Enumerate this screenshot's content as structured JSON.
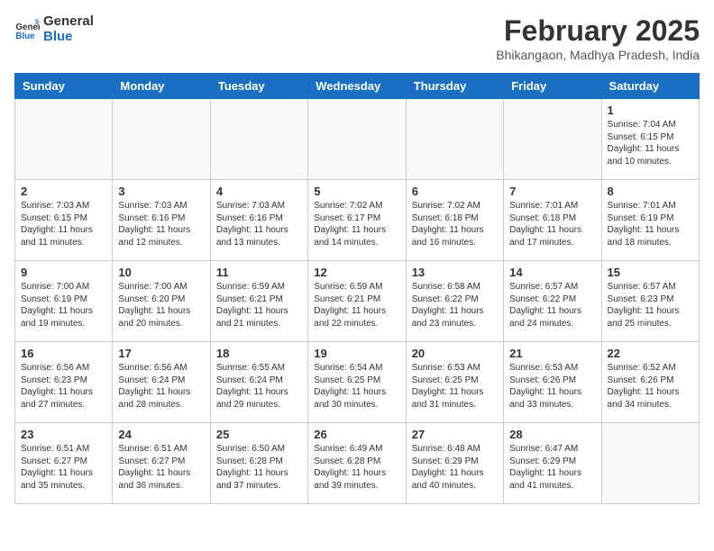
{
  "header": {
    "logo_line1": "General",
    "logo_line2": "Blue",
    "month": "February 2025",
    "location": "Bhikangaon, Madhya Pradesh, India"
  },
  "weekdays": [
    "Sunday",
    "Monday",
    "Tuesday",
    "Wednesday",
    "Thursday",
    "Friday",
    "Saturday"
  ],
  "weeks": [
    [
      {
        "day": "",
        "info": ""
      },
      {
        "day": "",
        "info": ""
      },
      {
        "day": "",
        "info": ""
      },
      {
        "day": "",
        "info": ""
      },
      {
        "day": "",
        "info": ""
      },
      {
        "day": "",
        "info": ""
      },
      {
        "day": "1",
        "info": "Sunrise: 7:04 AM\nSunset: 6:15 PM\nDaylight: 11 hours\nand 10 minutes."
      }
    ],
    [
      {
        "day": "2",
        "info": "Sunrise: 7:03 AM\nSunset: 6:15 PM\nDaylight: 11 hours\nand 11 minutes."
      },
      {
        "day": "3",
        "info": "Sunrise: 7:03 AM\nSunset: 6:16 PM\nDaylight: 11 hours\nand 12 minutes."
      },
      {
        "day": "4",
        "info": "Sunrise: 7:03 AM\nSunset: 6:16 PM\nDaylight: 11 hours\nand 13 minutes."
      },
      {
        "day": "5",
        "info": "Sunrise: 7:02 AM\nSunset: 6:17 PM\nDaylight: 11 hours\nand 14 minutes."
      },
      {
        "day": "6",
        "info": "Sunrise: 7:02 AM\nSunset: 6:18 PM\nDaylight: 11 hours\nand 16 minutes."
      },
      {
        "day": "7",
        "info": "Sunrise: 7:01 AM\nSunset: 6:18 PM\nDaylight: 11 hours\nand 17 minutes."
      },
      {
        "day": "8",
        "info": "Sunrise: 7:01 AM\nSunset: 6:19 PM\nDaylight: 11 hours\nand 18 minutes."
      }
    ],
    [
      {
        "day": "9",
        "info": "Sunrise: 7:00 AM\nSunset: 6:19 PM\nDaylight: 11 hours\nand 19 minutes."
      },
      {
        "day": "10",
        "info": "Sunrise: 7:00 AM\nSunset: 6:20 PM\nDaylight: 11 hours\nand 20 minutes."
      },
      {
        "day": "11",
        "info": "Sunrise: 6:59 AM\nSunset: 6:21 PM\nDaylight: 11 hours\nand 21 minutes."
      },
      {
        "day": "12",
        "info": "Sunrise: 6:59 AM\nSunset: 6:21 PM\nDaylight: 11 hours\nand 22 minutes."
      },
      {
        "day": "13",
        "info": "Sunrise: 6:58 AM\nSunset: 6:22 PM\nDaylight: 11 hours\nand 23 minutes."
      },
      {
        "day": "14",
        "info": "Sunrise: 6:57 AM\nSunset: 6:22 PM\nDaylight: 11 hours\nand 24 minutes."
      },
      {
        "day": "15",
        "info": "Sunrise: 6:57 AM\nSunset: 6:23 PM\nDaylight: 11 hours\nand 25 minutes."
      }
    ],
    [
      {
        "day": "16",
        "info": "Sunrise: 6:56 AM\nSunset: 6:23 PM\nDaylight: 11 hours\nand 27 minutes."
      },
      {
        "day": "17",
        "info": "Sunrise: 6:56 AM\nSunset: 6:24 PM\nDaylight: 11 hours\nand 28 minutes."
      },
      {
        "day": "18",
        "info": "Sunrise: 6:55 AM\nSunset: 6:24 PM\nDaylight: 11 hours\nand 29 minutes."
      },
      {
        "day": "19",
        "info": "Sunrise: 6:54 AM\nSunset: 6:25 PM\nDaylight: 11 hours\nand 30 minutes."
      },
      {
        "day": "20",
        "info": "Sunrise: 6:53 AM\nSunset: 6:25 PM\nDaylight: 11 hours\nand 31 minutes."
      },
      {
        "day": "21",
        "info": "Sunrise: 6:53 AM\nSunset: 6:26 PM\nDaylight: 11 hours\nand 33 minutes."
      },
      {
        "day": "22",
        "info": "Sunrise: 6:52 AM\nSunset: 6:26 PM\nDaylight: 11 hours\nand 34 minutes."
      }
    ],
    [
      {
        "day": "23",
        "info": "Sunrise: 6:51 AM\nSunset: 6:27 PM\nDaylight: 11 hours\nand 35 minutes."
      },
      {
        "day": "24",
        "info": "Sunrise: 6:51 AM\nSunset: 6:27 PM\nDaylight: 11 hours\nand 36 minutes."
      },
      {
        "day": "25",
        "info": "Sunrise: 6:50 AM\nSunset: 6:28 PM\nDaylight: 11 hours\nand 37 minutes."
      },
      {
        "day": "26",
        "info": "Sunrise: 6:49 AM\nSunset: 6:28 PM\nDaylight: 11 hours\nand 39 minutes."
      },
      {
        "day": "27",
        "info": "Sunrise: 6:48 AM\nSunset: 6:29 PM\nDaylight: 11 hours\nand 40 minutes."
      },
      {
        "day": "28",
        "info": "Sunrise: 6:47 AM\nSunset: 6:29 PM\nDaylight: 11 hours\nand 41 minutes."
      },
      {
        "day": "",
        "info": ""
      }
    ]
  ]
}
